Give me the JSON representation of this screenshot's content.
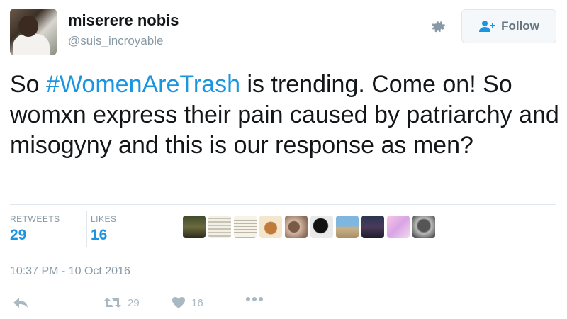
{
  "author": {
    "name": "miserere nobis",
    "handle": "@suis_incroyable"
  },
  "follow_label": "Follow",
  "tweet": {
    "text_before": "So ",
    "hashtag": "#WomenAreTrash",
    "text_after": " is trending. Come on! So womxn express their pain caused by patriarchy and misogyny and this is our response as men?"
  },
  "stats": {
    "retweets_label": "RETWEETS",
    "retweets_value": "29",
    "likes_label": "LIKES",
    "likes_value": "16"
  },
  "timestamp": "10:37 PM - 10 Oct 2016",
  "actions": {
    "retweet_count": "29",
    "like_count": "16"
  },
  "icons": [
    "gear-icon",
    "add-user-icon",
    "reply-icon",
    "retweet-icon",
    "heart-icon",
    "more-icon"
  ],
  "colors": {
    "link": "#1b95e0",
    "muted": "#8899a6",
    "text": "#14171a"
  }
}
